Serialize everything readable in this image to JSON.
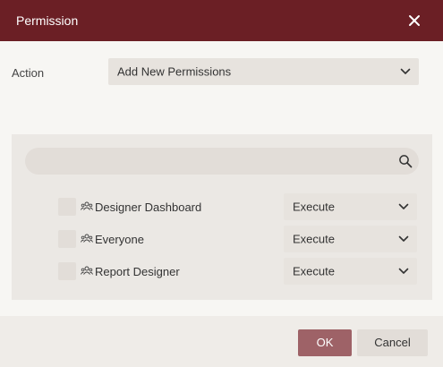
{
  "dialog": {
    "title": "Permission",
    "close_icon": "close-icon"
  },
  "action": {
    "label": "Action",
    "selected": "Add New Permissions"
  },
  "search": {
    "value": "",
    "placeholder": "",
    "icon": "search-icon"
  },
  "permissions": [
    {
      "name": "Designer Dashboard",
      "icon": "group-icon",
      "checked": false,
      "permission": "Execute"
    },
    {
      "name": "Everyone",
      "icon": "group-icon",
      "checked": false,
      "permission": "Execute"
    },
    {
      "name": "Report Designer",
      "icon": "group-icon",
      "checked": false,
      "permission": "Execute"
    }
  ],
  "footer": {
    "ok_label": "OK",
    "cancel_label": "Cancel"
  },
  "colors": {
    "titlebar": "#6b1f25",
    "ok_button": "#9e6267",
    "control_bg": "#e7e3de",
    "panel_bg": "#ebe8e4"
  }
}
